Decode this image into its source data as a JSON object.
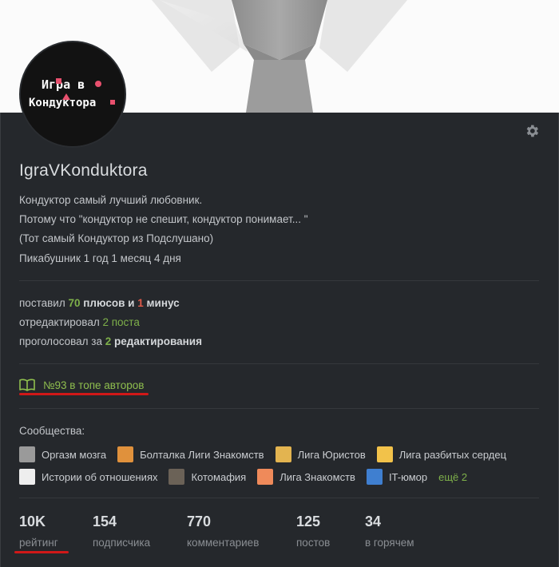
{
  "profile": {
    "username": "IgraVKonduktora",
    "avatar_text_line1": "Игра в",
    "avatar_text_line2": "Кондуктора",
    "about": [
      "Кондуктор самый лучший любовник.",
      "Потому что \"кондуктор не спешит, кондуктор понимает... \"",
      "(Тот самый Кондуктор из Подслушано)"
    ],
    "since": "Пикабушник 1 год 1 месяц 4 дня"
  },
  "activity": {
    "line1_prefix": "поставил",
    "plus_count": "70",
    "plus_word": "плюсов",
    "and_word": "и",
    "minus_count": "1",
    "minus_word": "минус",
    "line2_prefix": "отредактировал",
    "edited": "2 поста",
    "line3_prefix": "проголосовал за",
    "voted_count": "2",
    "voted_word": "редактирования"
  },
  "top_authors": {
    "label": "№93 в топе авторов",
    "icon": "book-icon"
  },
  "communities": {
    "title": "Сообщества:",
    "row1": [
      {
        "label": "Оргазм мозга",
        "color": "#9a9a9a"
      },
      {
        "label": "Болталка Лиги Знакомств",
        "color": "#e0913c"
      },
      {
        "label": "Лига Юристов",
        "color": "#e3b450"
      },
      {
        "label": "Лига разбитых сердец",
        "color": "#f2c24a"
      }
    ],
    "row2": [
      {
        "label": "Истории об отношениях",
        "color": "#eeeeee"
      },
      {
        "label": "Котомафия",
        "color": "#6b6257"
      },
      {
        "label": "Лига Знакомств",
        "color": "#ef8a5a"
      },
      {
        "label": "IT-юмор",
        "color": "#3f7fd0"
      }
    ],
    "more": "ещё 2"
  },
  "counters": [
    {
      "value": "10K",
      "label": "рейтинг"
    },
    {
      "value": "154",
      "label": "подписчика"
    },
    {
      "value": "770",
      "label": "комментариев"
    },
    {
      "value": "125",
      "label": "постов"
    },
    {
      "value": "34",
      "label": "в горячем"
    }
  ],
  "colors": {
    "accent_green": "#7eb04a",
    "accent_red": "#e05a4a",
    "annotation_red": "#d01818",
    "panel_bg": "#25282c"
  }
}
